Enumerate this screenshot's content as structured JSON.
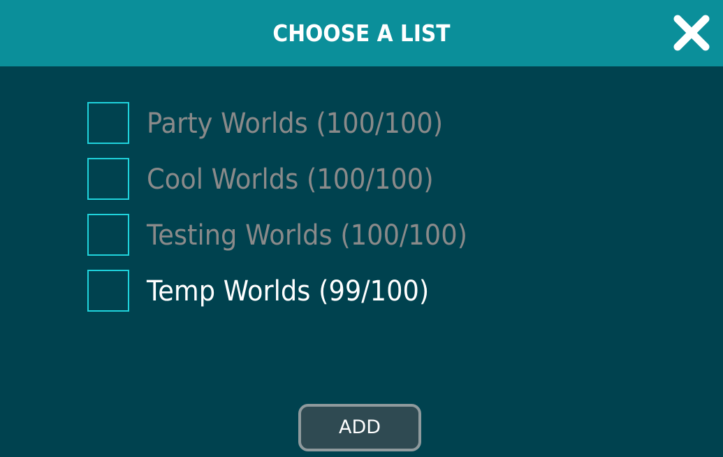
{
  "dialog": {
    "title": "CHOOSE A LIST",
    "close_icon": "close-icon",
    "lists": [
      {
        "label": "Party Worlds (100/100)",
        "checked": false,
        "enabled": false
      },
      {
        "label": "Cool Worlds (100/100)",
        "checked": false,
        "enabled": false
      },
      {
        "label": "Testing Worlds (100/100)",
        "checked": false,
        "enabled": false
      },
      {
        "label": "Temp Worlds (99/100)",
        "checked": false,
        "enabled": true
      }
    ],
    "add_label": "ADD"
  },
  "colors": {
    "header": "#0b8f9a",
    "background": "#00424f",
    "checkbox_border": "#1fd3dc",
    "disabled_text": "#8a8a8a",
    "enabled_text": "#ffffff",
    "button_bg": "#2f4a52",
    "button_border": "#8f9a9d"
  }
}
